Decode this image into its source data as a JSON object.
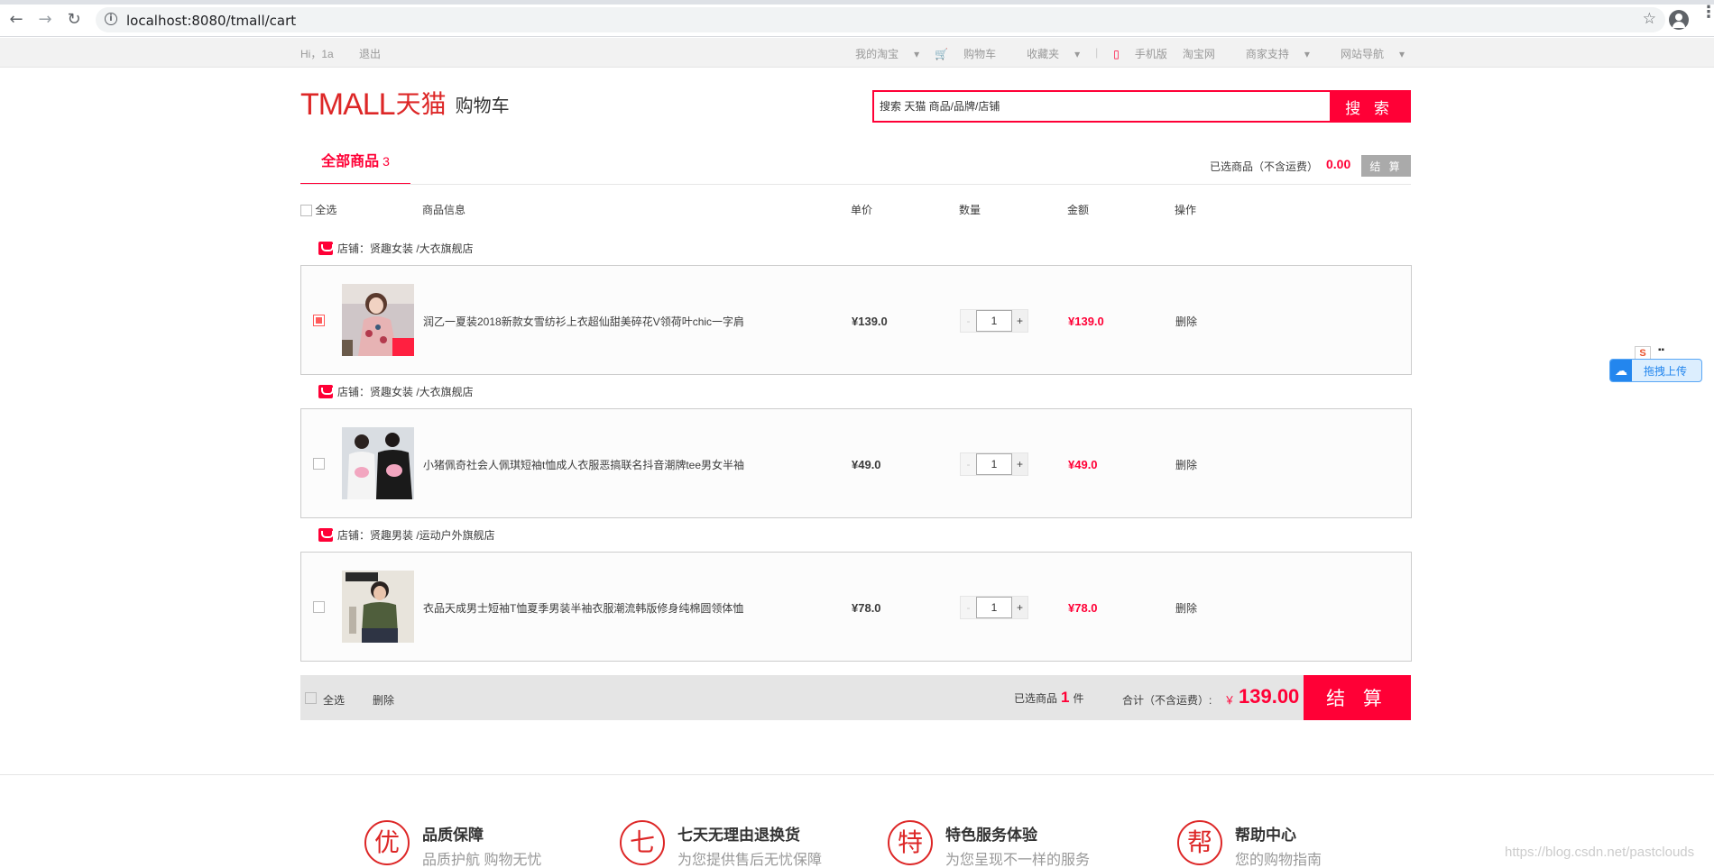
{
  "browser": {
    "url": "localhost:8080/tmall/cart",
    "info_glyph": "i",
    "back": "←",
    "forward": "→",
    "reload": "↻",
    "star": "☆",
    "menu": "⋮"
  },
  "topbar": {
    "greeting": "Hi，1a",
    "logout": "退出",
    "my_taobao": "我的淘宝",
    "cart": "购物车",
    "favorites": "收藏夹",
    "mobile": "手机版",
    "taobao": "淘宝网",
    "merchant": "商家支持",
    "sitenav": "网站导航",
    "separator": "|",
    "caret": "▾",
    "cart_glyph": "🛒",
    "mobile_glyph": "▯"
  },
  "header": {
    "logo_en": "TMALL",
    "logo_cn": "天猫",
    "page_title": "购物车",
    "search_placeholder": "搜索 天猫 商品/品牌/店铺",
    "search_button": "搜 索"
  },
  "tabs": {
    "all_label": "全部商品",
    "all_count": "3",
    "selected_label": "已选商品（不含运费）",
    "selected_amount": "0.00",
    "settle_small": "结 算"
  },
  "columns": {
    "select_all": "全选",
    "info": "商品信息",
    "unit_price": "单价",
    "quantity": "数量",
    "amount": "金额",
    "operation": "操作"
  },
  "items": [
    {
      "shop": "店铺：贤趣女装 /大衣旗舰店",
      "name": "润乙一夏装2018新款女雪纺衫上衣超仙甜美碎花V领荷叶chic一字肩",
      "price": "¥139.0",
      "qty": "1",
      "total": "¥139.0",
      "delete": "删除",
      "checked": true
    },
    {
      "shop": "店铺：贤趣女装 /大衣旗舰店",
      "name": "小猪佩奇社会人佩琪短袖t恤成人衣服恶搞联名抖音潮牌tee男女半袖",
      "price": "¥49.0",
      "qty": "1",
      "total": "¥49.0",
      "delete": "删除",
      "checked": false
    },
    {
      "shop": "店铺：贤趣男装 /运动户外旗舰店",
      "name": "衣品天成男士短袖T恤夏季男装半袖衣服潮流韩版修身纯棉圆领体恤",
      "price": "¥78.0",
      "qty": "1",
      "total": "¥78.0",
      "delete": "删除",
      "checked": false
    }
  ],
  "qty_controls": {
    "minus": "-",
    "plus": "+"
  },
  "footer_bar": {
    "select_all": "全选",
    "delete": "删除",
    "chosen_prefix": "已选商品",
    "chosen_count": "1",
    "chosen_suffix": "件",
    "total_label": "合计（不含运费）:",
    "currency": "￥",
    "total_amount": "139.00",
    "settle": "结 算"
  },
  "services": [
    {
      "glyph": "优",
      "title": "品质保障",
      "desc": "品质护航 购物无忧"
    },
    {
      "glyph": "七",
      "title": "七天无理由退换货",
      "desc": "为您提供售后无忧保障"
    },
    {
      "glyph": "特",
      "title": "特色服务体验",
      "desc": "为您呈现不一样的服务"
    },
    {
      "glyph": "帮",
      "title": "帮助中心",
      "desc": "您的购物指南"
    }
  ],
  "side_widget": {
    "s_label": "S",
    "dash": "▪▪",
    "upload": "拖拽上传",
    "cloud": "☁"
  },
  "watermark": "https://blog.csdn.net/pastclouds",
  "colors": {
    "accent": "#ff0036",
    "brand": "#dd2727"
  }
}
